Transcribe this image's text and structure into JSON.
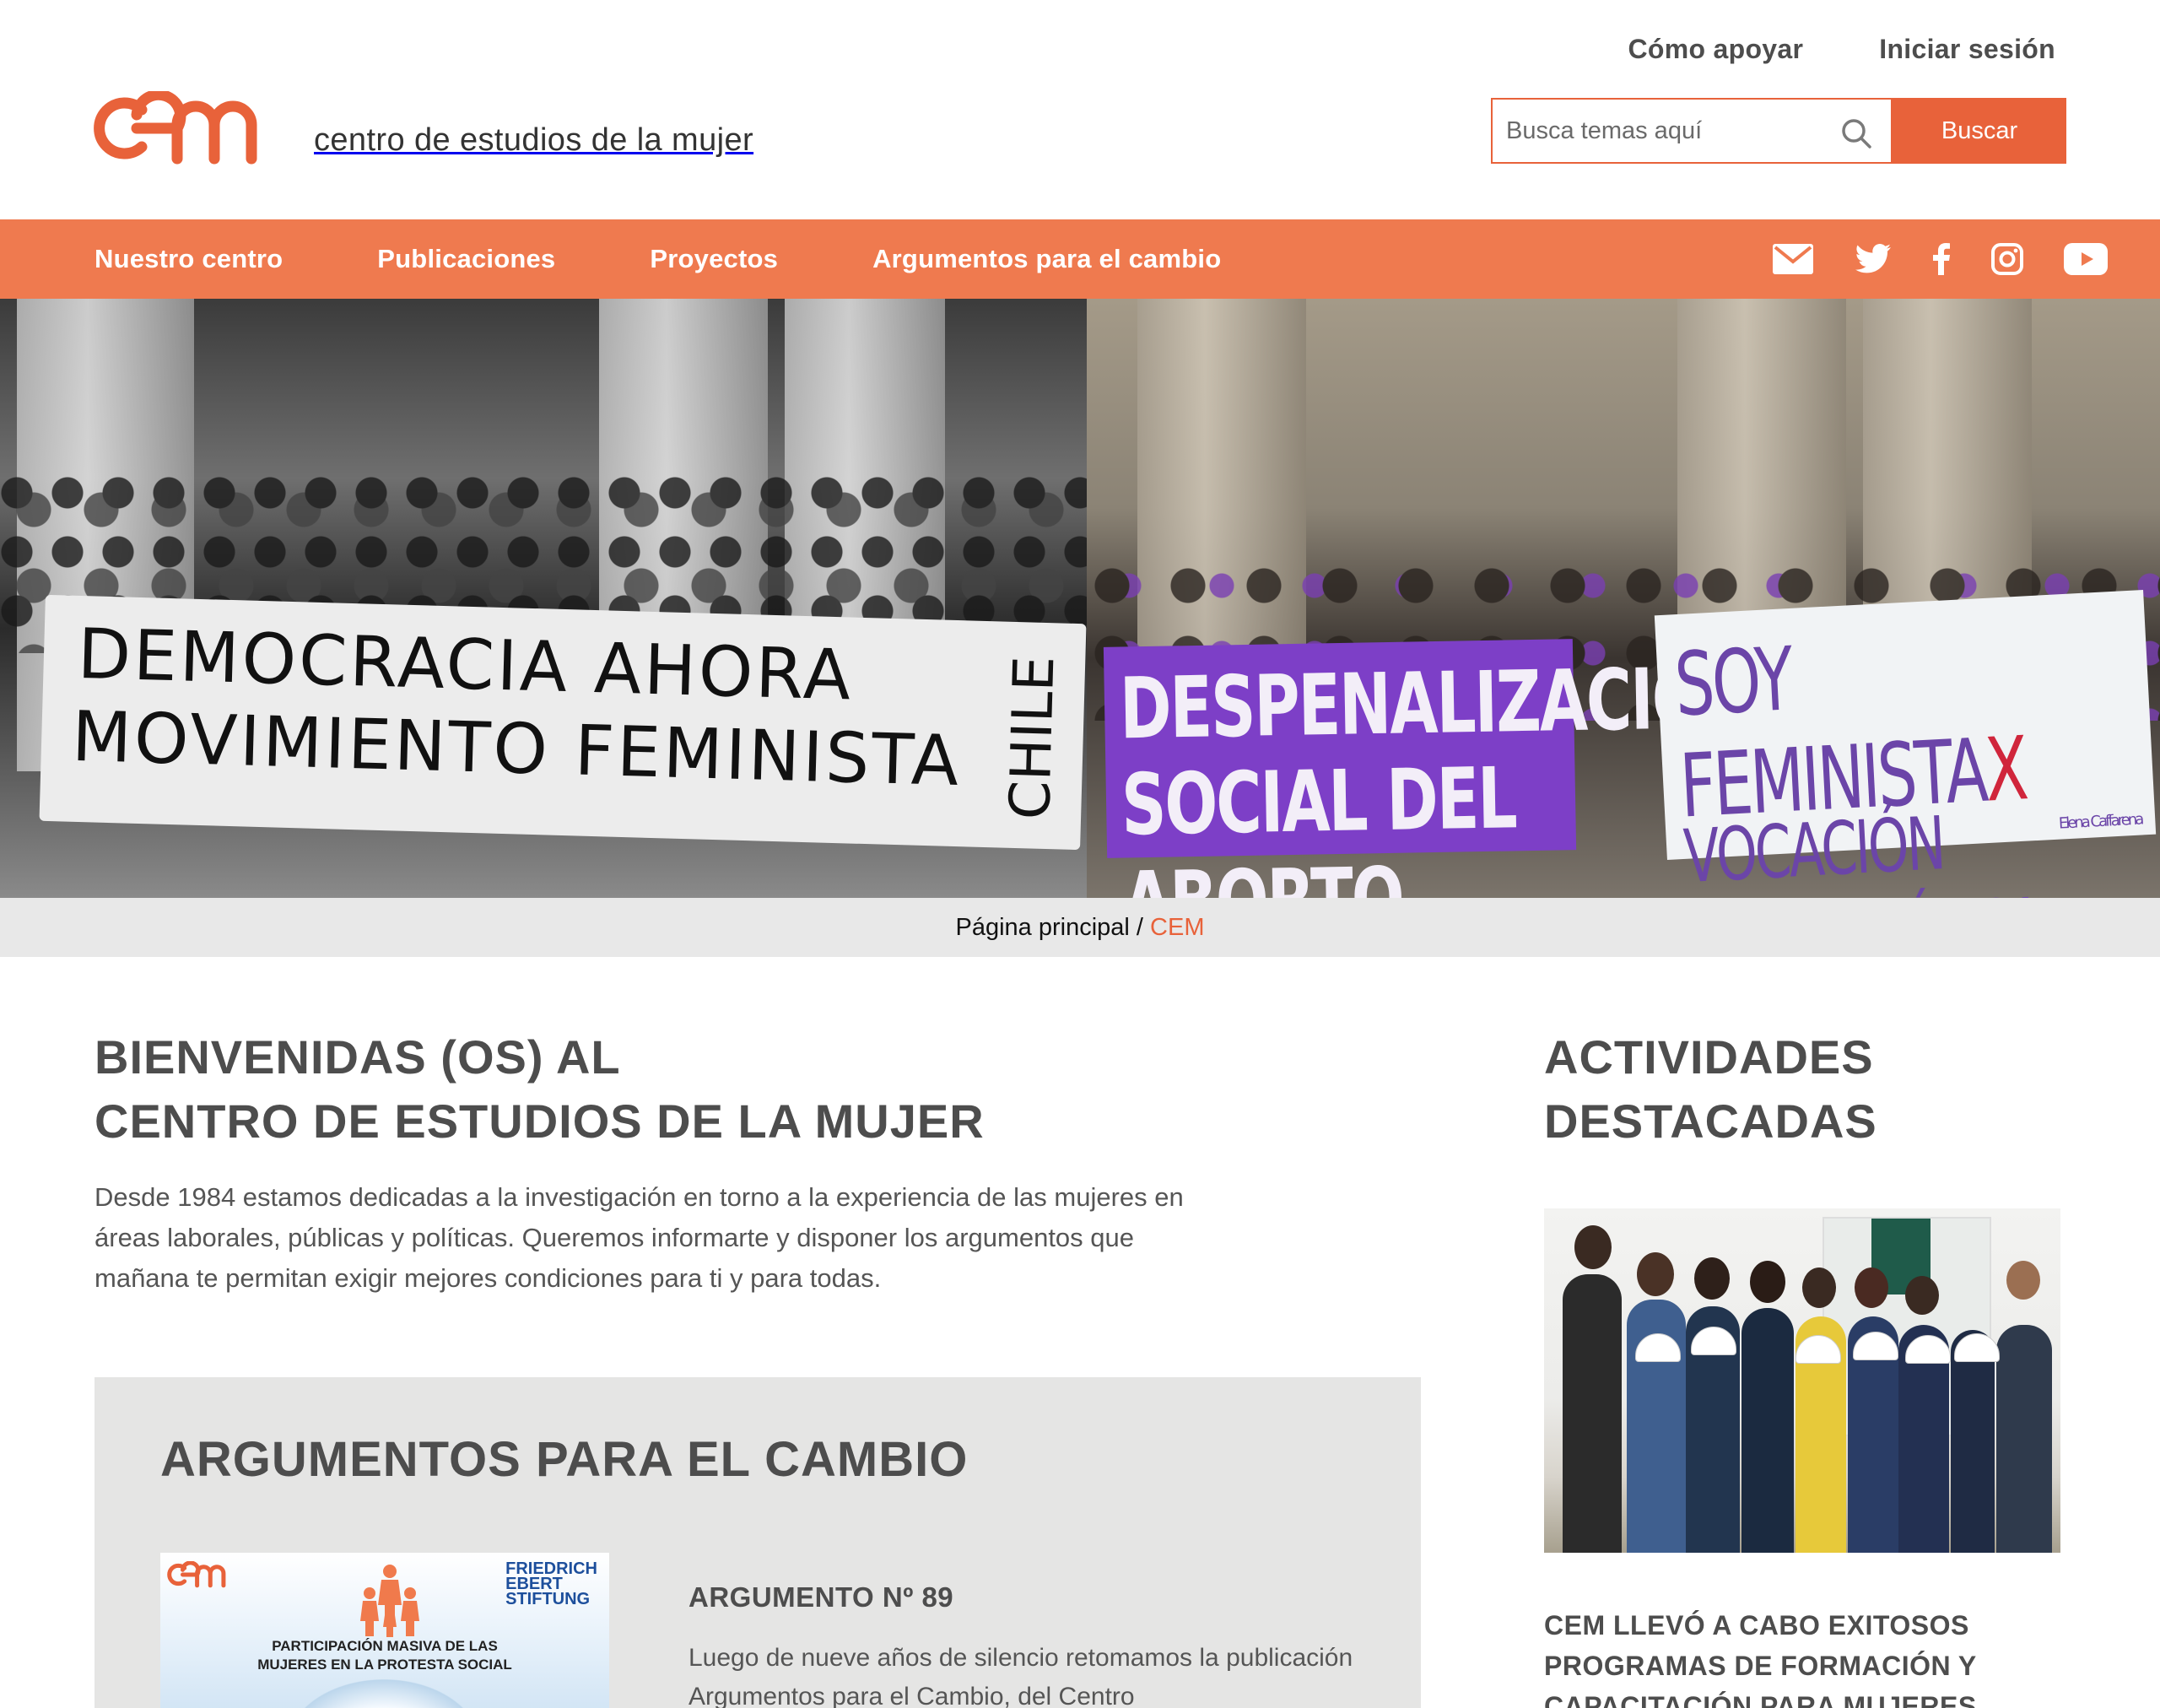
{
  "header": {
    "top_links": [
      "Cómo apoyar",
      "Iniciar sesión"
    ],
    "logo_text": "centro de estudios de la mujer",
    "search_placeholder": "Busca temas aquí",
    "search_button": "Buscar"
  },
  "nav": {
    "items": [
      "Nuestro centro",
      "Publicaciones",
      "Proyectos",
      "Argumentos para el cambio"
    ],
    "social_icons": [
      "mail-icon",
      "twitter-icon",
      "facebook-icon",
      "instagram-icon",
      "youtube-icon"
    ]
  },
  "hero": {
    "left_banner": {
      "line1": "DEMOCRACIA AHORA",
      "line2": "MOVIMIENTO FEMINISTA",
      "side": "CHILE"
    },
    "right_banner_purple": {
      "line1": "DESPENALIZACION",
      "line2": "SOCIAL DEL ABORTO"
    },
    "right_banner_white": {
      "line1": "SOY FEMINISTA",
      "mark": "X",
      "line2": "VOCACIÓN DEMOCRÁTICA",
      "signature": "Elena Caffarena"
    }
  },
  "breadcrumb": {
    "home": "Página principal",
    "separator": "/",
    "current": "CEM"
  },
  "welcome": {
    "title_line1": "BIENVENIDAS (OS) AL",
    "title_line2": "CENTRO DE ESTUDIOS DE LA MUJER",
    "text": "Desde 1984 estamos dedicadas a la investigación en torno a la experiencia de las mujeres en áreas laborales, públicas y políticas. Queremos informarte y disponer los argumentos que mañana te permitan exigir mejores condiciones para ti y para todas."
  },
  "arguments": {
    "title": "ARGUMENTOS PARA EL CAMBIO",
    "thumb_caption_line1": "PARTICIPACIÓN MASIVA DE LAS",
    "thumb_caption_line2": "MUJERES EN LA PROTESTA SOCIAL",
    "thumb_fes": [
      "FRIEDRICH",
      "EBERT",
      "STIFTUNG"
    ],
    "item_title": "ARGUMENTO Nº 89",
    "item_text": "Luego de nueve años de silencio retomamos la publicación Argumentos para el Cambio, del Centro"
  },
  "sidebar": {
    "title_line1": "ACTIVIDADES",
    "title_line2": "DESTACADAS",
    "caption": "CEM LLEVÓ A CABO EXITOSOS PROGRAMAS DE FORMACIÓN Y CAPACITACIÓN PARA MUJERES"
  },
  "colors": {
    "accent": "#e8623a",
    "nav_bg": "#ef7a4f",
    "breadcrumb_bg": "#e8e8e8",
    "panel_bg": "#e5e5e4",
    "purple": "#7d3fc7"
  }
}
